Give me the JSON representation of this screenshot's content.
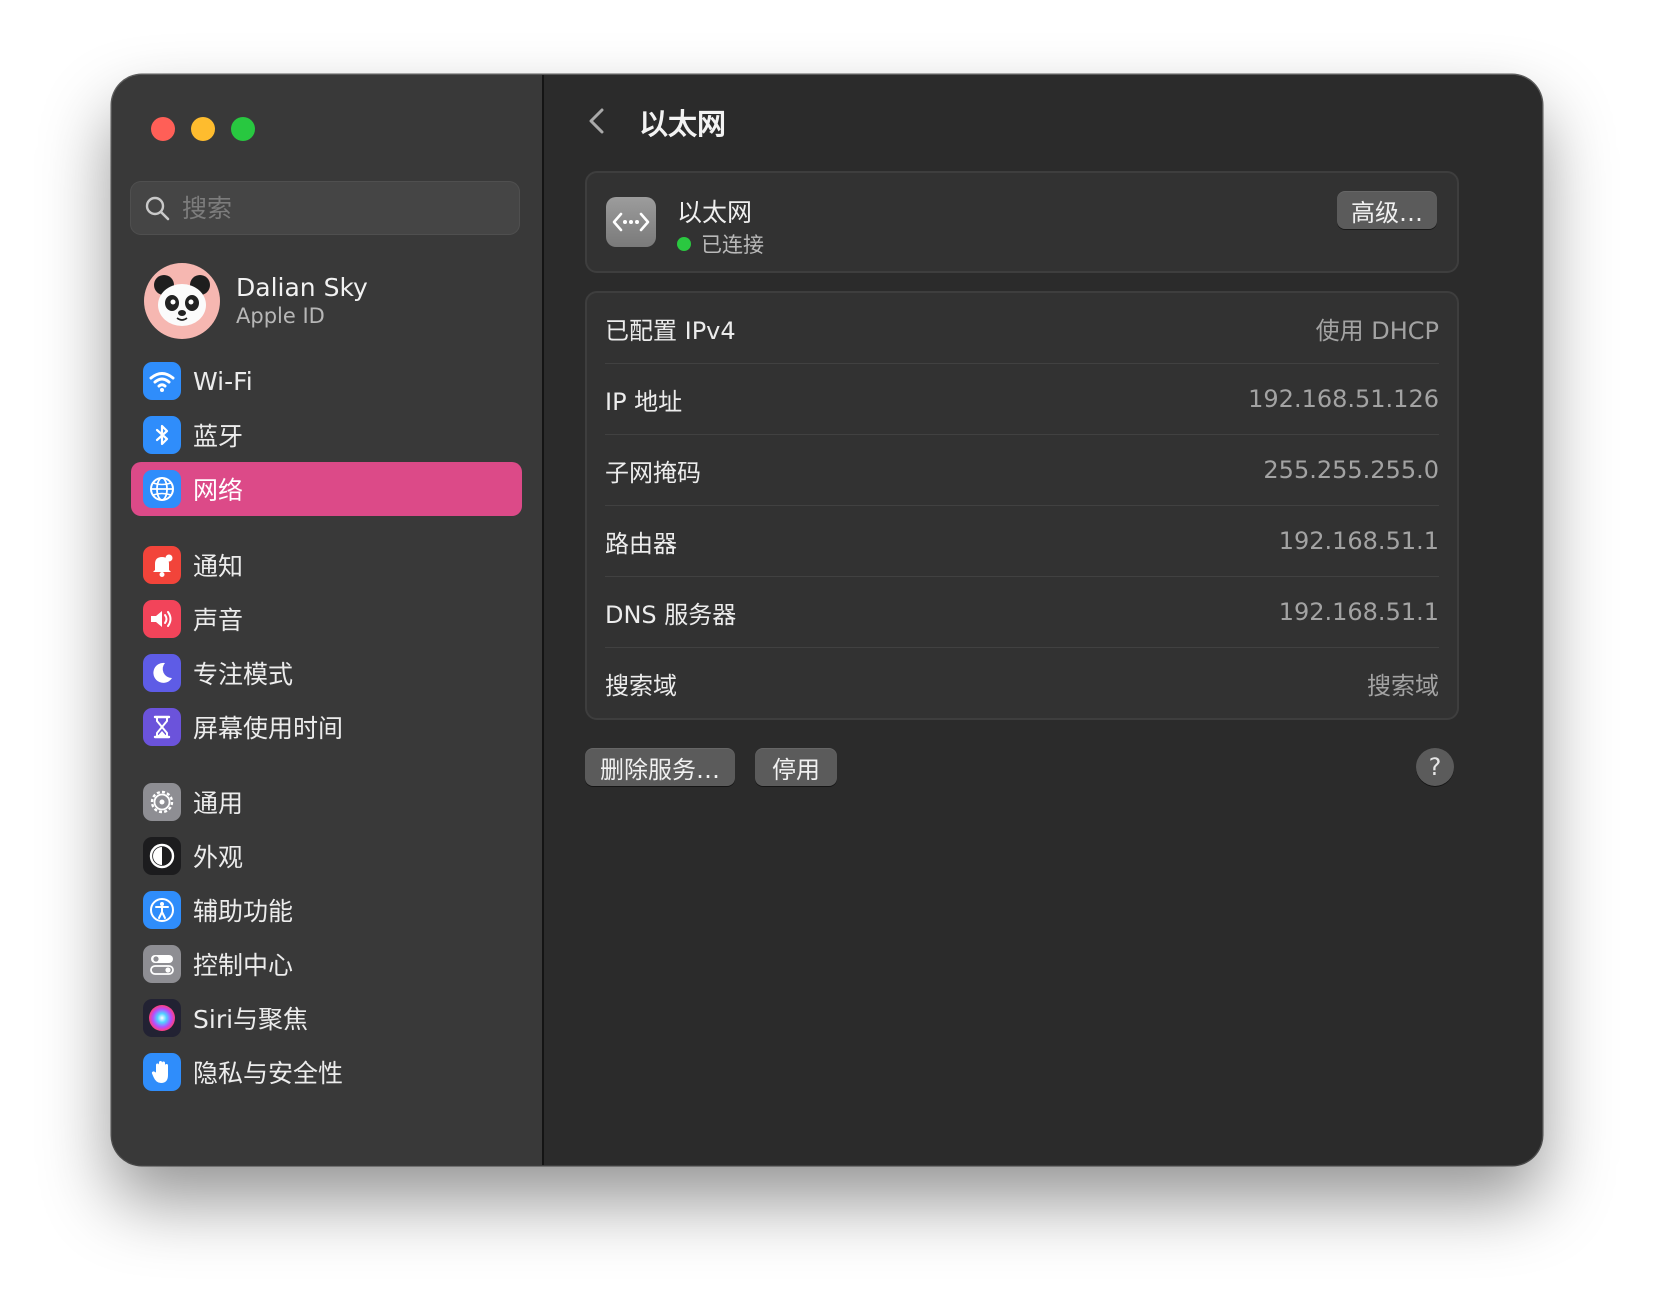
{
  "window": {
    "controls": {
      "close_color": "#ff5f57",
      "minimize_color": "#febc2e",
      "zoom_color": "#28c840"
    }
  },
  "sidebar": {
    "search": {
      "placeholder": "搜索",
      "value": ""
    },
    "profile": {
      "name": "Dalian Sky",
      "subtitle": "Apple ID"
    },
    "accent_color": "#dc4a88",
    "groups": [
      [
        {
          "id": "wifi",
          "label": "Wi-Fi",
          "icon": "wifi-icon",
          "icon_bg": "#2f8dfb"
        },
        {
          "id": "bluetooth",
          "label": "蓝牙",
          "icon": "bluetooth-icon",
          "icon_bg": "#2f8dfb"
        },
        {
          "id": "network",
          "label": "网络",
          "icon": "globe-icon",
          "icon_bg": "#2f8dfb",
          "selected": true
        }
      ],
      [
        {
          "id": "notifications",
          "label": "通知",
          "icon": "bell-icon",
          "icon_bg": "#f2443a"
        },
        {
          "id": "sound",
          "label": "声音",
          "icon": "speaker-icon",
          "icon_bg": "#f2445a"
        },
        {
          "id": "focus",
          "label": "专注模式",
          "icon": "moon-icon",
          "icon_bg": "#5e5ce6"
        },
        {
          "id": "screen-time",
          "label": "屏幕使用时间",
          "icon": "hourglass-icon",
          "icon_bg": "#6b53db"
        }
      ],
      [
        {
          "id": "general",
          "label": "通用",
          "icon": "gear-icon",
          "icon_bg": "#8e8e93"
        },
        {
          "id": "appearance",
          "label": "外观",
          "icon": "appearance-icon",
          "icon_bg": "#1c1c1e"
        },
        {
          "id": "accessibility",
          "label": "辅助功能",
          "icon": "accessibility-icon",
          "icon_bg": "#2f8dfb"
        },
        {
          "id": "control-center",
          "label": "控制中心",
          "icon": "toggles-icon",
          "icon_bg": "#8e8e93"
        },
        {
          "id": "siri",
          "label": "Siri与聚焦",
          "icon": "siri-icon",
          "icon_bg": "#222233"
        },
        {
          "id": "privacy",
          "label": "隐私与安全性",
          "icon": "hand-icon",
          "icon_bg": "#2f8dfb"
        }
      ]
    ]
  },
  "main": {
    "title": "以太网",
    "service": {
      "name": "以太网",
      "status": "已连接",
      "status_color": "#2ac840",
      "icon": "ethernet-icon",
      "advanced_label": "高级…"
    },
    "details": [
      {
        "label": "已配置 IPv4",
        "value": "使用 DHCP"
      },
      {
        "label": "IP 地址",
        "value": "192.168.51.126"
      },
      {
        "label": "子网掩码",
        "value": "255.255.255.0"
      },
      {
        "label": "路由器",
        "value": "192.168.51.1"
      },
      {
        "label": "DNS 服务器",
        "value": "192.168.51.1"
      },
      {
        "label": "搜索域",
        "value": "搜索域"
      }
    ],
    "buttons": {
      "remove": "删除服务…",
      "disable": "停用",
      "help": "?"
    }
  }
}
